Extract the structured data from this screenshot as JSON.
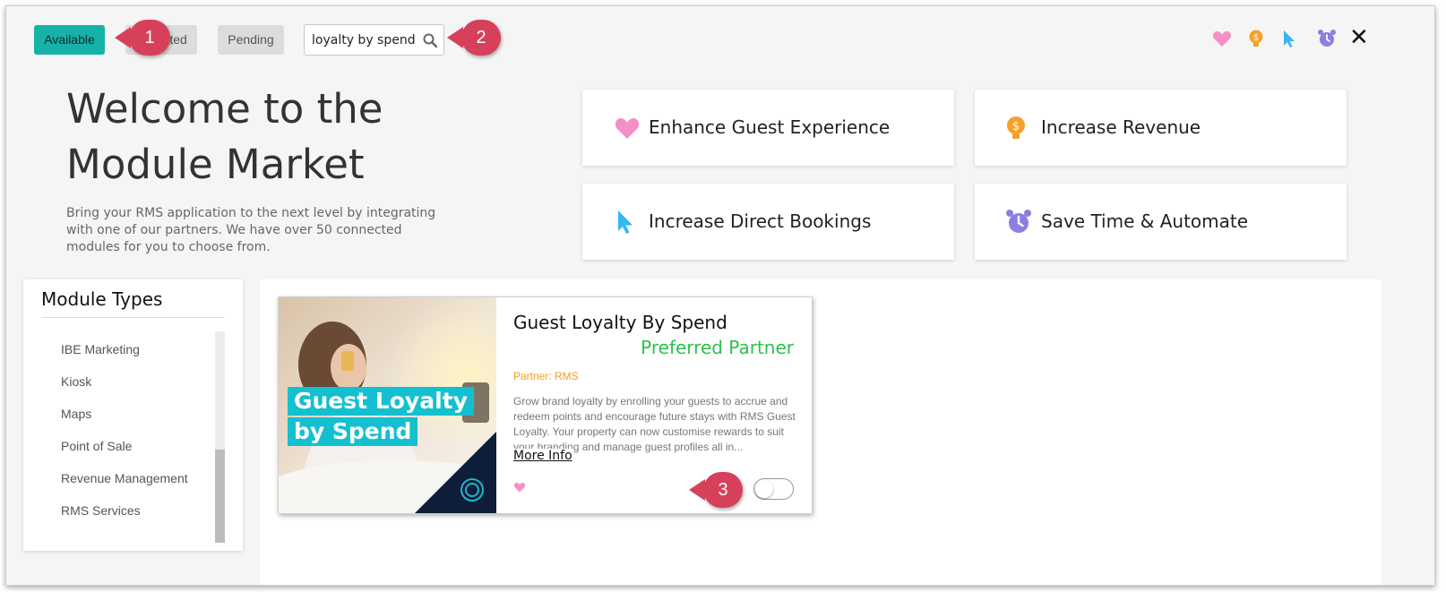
{
  "tabs": {
    "available": "Available",
    "activated": "Activated",
    "pending": "Pending"
  },
  "search": {
    "value": "loyalty by spend"
  },
  "callouts": {
    "one": "1",
    "two": "2",
    "three": "3"
  },
  "colors": {
    "accent": "#16b2a8",
    "callout": "#d6405a",
    "heart": "#f48fc8",
    "bulb": "#f5a02a",
    "cursor": "#36b6f0",
    "alarm": "#8b7fe0",
    "preferred": "#2cc24a",
    "partner": "#f0a020"
  },
  "top_icons": [
    "heart-icon",
    "lightbulb-dollar-icon",
    "cursor-icon",
    "alarm-clock-icon",
    "close-icon"
  ],
  "hero": {
    "title_line1": "Welcome to the",
    "title_line2": "Module Market",
    "description": "Bring your RMS application to the next level by integrating with one of our partners. We have over 50 connected modules for you to choose from."
  },
  "categories": {
    "enhance": "Enhance Guest Experience",
    "revenue": "Increase Revenue",
    "direct": "Increase Direct Bookings",
    "automate": "Save Time & Automate"
  },
  "sidebar": {
    "title": "Module Types",
    "items": [
      "IBE Marketing",
      "Kiosk",
      "Maps",
      "Point of Sale",
      "Revenue Management",
      "RMS Services"
    ]
  },
  "module": {
    "title": "Guest Loyalty By Spend",
    "badge": "Preferred Partner",
    "partner": "Partner: RMS",
    "description": "Grow brand loyalty by enrolling your guests to accrue and redeem points and encourage future stays with RMS Guest Loyalty. Your property can now customise rewards to suit your branding and manage guest profiles all in...",
    "more_info": "More Info",
    "image_text_line1": "Guest Loyalty",
    "image_text_line2": "by Spend",
    "toggle_state": "off"
  }
}
